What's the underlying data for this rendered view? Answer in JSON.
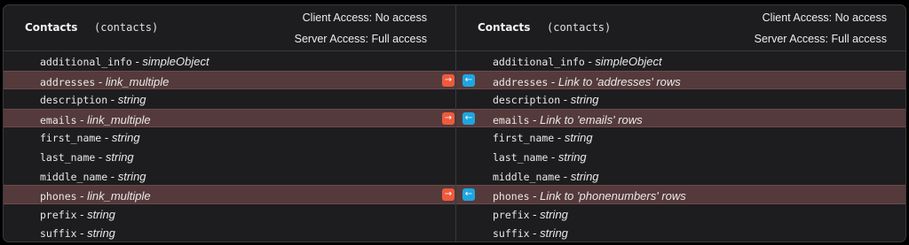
{
  "left": {
    "title": "Contacts",
    "id": "(contacts)",
    "client_access": "Client Access: No access",
    "server_access": "Server Access: Full access",
    "fields": [
      {
        "name": "additional_info",
        "sep": " - ",
        "type": "simpleObject",
        "highlighted": false
      },
      {
        "name": "addresses",
        "sep": " - ",
        "type": "link_multiple",
        "highlighted": true
      },
      {
        "name": "description",
        "sep": " - ",
        "type": "string",
        "highlighted": false
      },
      {
        "name": "emails",
        "sep": " - ",
        "type": "link_multiple",
        "highlighted": true
      },
      {
        "name": "first_name",
        "sep": " - ",
        "type": "string",
        "highlighted": false
      },
      {
        "name": "last_name",
        "sep": " - ",
        "type": "string",
        "highlighted": false
      },
      {
        "name": "middle_name",
        "sep": " - ",
        "type": "string",
        "highlighted": false
      },
      {
        "name": "phones",
        "sep": " - ",
        "type": "link_multiple",
        "highlighted": true
      },
      {
        "name": "prefix",
        "sep": " - ",
        "type": "string",
        "highlighted": false
      },
      {
        "name": "suffix",
        "sep": " - ",
        "type": "string",
        "highlighted": false
      }
    ]
  },
  "right": {
    "title": "Contacts",
    "id": "(contacts)",
    "client_access": "Client Access: No access",
    "server_access": "Server Access: Full access",
    "fields": [
      {
        "name": "additional_info",
        "sep": " - ",
        "type": "simpleObject",
        "highlighted": false
      },
      {
        "name": "addresses",
        "sep": " - ",
        "type": "Link to 'addresses' rows",
        "highlighted": true
      },
      {
        "name": "description",
        "sep": " - ",
        "type": "string",
        "highlighted": false
      },
      {
        "name": "emails",
        "sep": " - ",
        "type": "Link to 'emails' rows",
        "highlighted": true
      },
      {
        "name": "first_name",
        "sep": " - ",
        "type": "string",
        "highlighted": false
      },
      {
        "name": "last_name",
        "sep": " - ",
        "type": "string",
        "highlighted": false
      },
      {
        "name": "middle_name",
        "sep": " - ",
        "type": "string",
        "highlighted": false
      },
      {
        "name": "phones",
        "sep": " - ",
        "type": "Link to 'phonenumbers' rows",
        "highlighted": true
      },
      {
        "name": "prefix",
        "sep": " - ",
        "type": "string",
        "highlighted": false
      },
      {
        "name": "suffix",
        "sep": " - ",
        "type": "string",
        "highlighted": false
      }
    ]
  },
  "icons": {
    "out_arrow": "arrow-right-icon",
    "in_arrow": "arrow-left-icon",
    "out_glyph": "→",
    "in_glyph": "←"
  },
  "colors": {
    "highlight_row": "#553a3c",
    "out_arrow": "#ee5a3c",
    "in_arrow": "#1ea6e0"
  }
}
